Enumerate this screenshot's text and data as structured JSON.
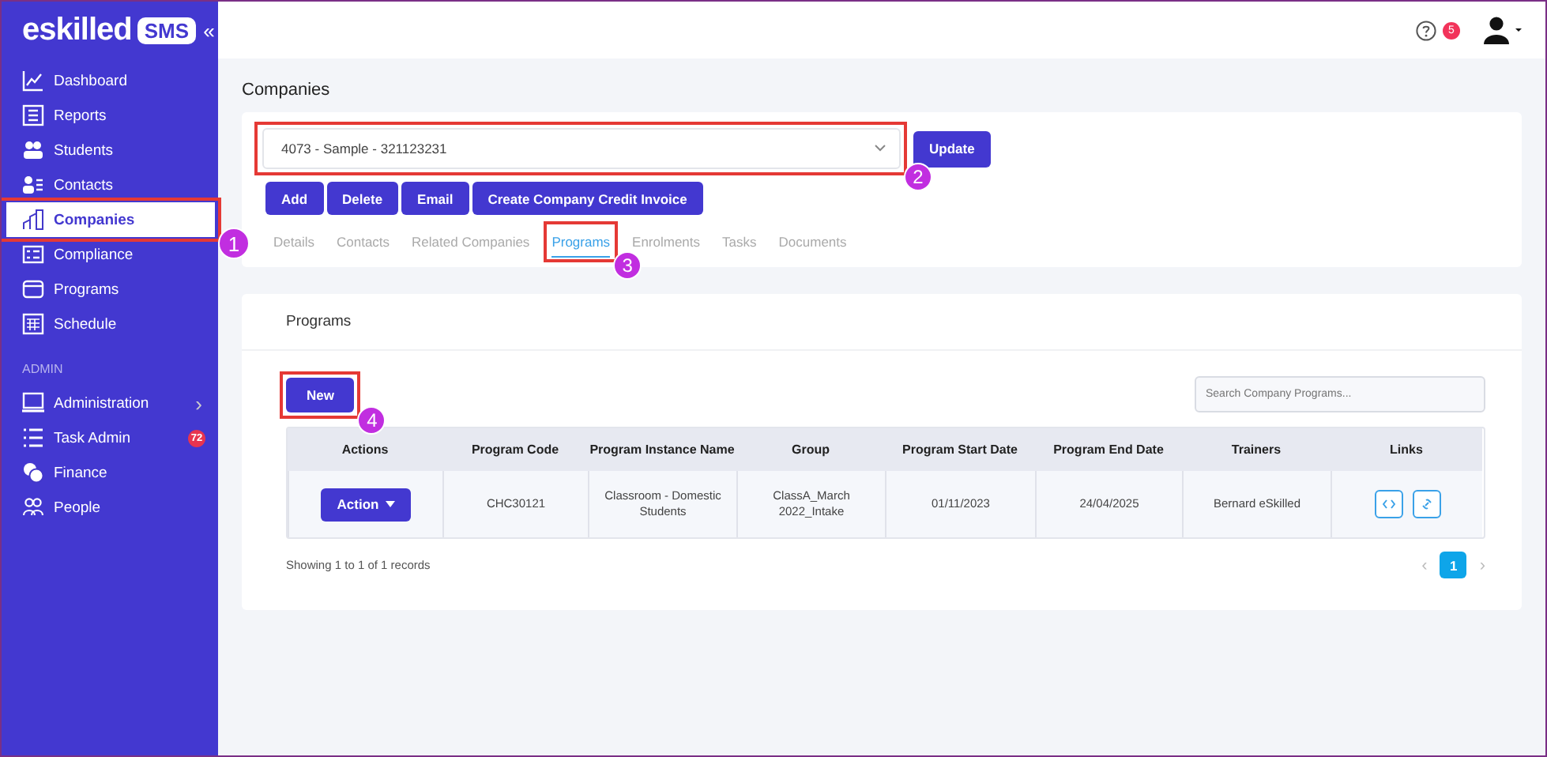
{
  "logo": {
    "text": "eskilled",
    "badge": "SMS",
    "collapse": "«"
  },
  "sidebar": {
    "items": [
      {
        "label": "Dashboard",
        "selected": false
      },
      {
        "label": "Reports",
        "selected": false
      },
      {
        "label": "Students",
        "selected": false
      },
      {
        "label": "Contacts",
        "selected": false
      },
      {
        "label": "Companies",
        "selected": true,
        "callout": "1"
      },
      {
        "label": "Compliance",
        "selected": false
      },
      {
        "label": "Programs",
        "selected": false
      },
      {
        "label": "Schedule",
        "selected": false
      }
    ],
    "section": "ADMIN",
    "admin_items": [
      {
        "label": "Administration",
        "selected": false,
        "chevron": "›"
      },
      {
        "label": "Task Admin",
        "selected": false,
        "badge": "72"
      },
      {
        "label": "Finance",
        "selected": false
      },
      {
        "label": "People",
        "selected": false
      }
    ]
  },
  "topbar": {
    "notification_count": "5"
  },
  "page_title": "Companies",
  "company": {
    "value": "4073 - Sample - 321123231",
    "callout": "2",
    "update": "Update",
    "buttons": [
      "Add",
      "Delete",
      "Email",
      "Create Company Credit Invoice"
    ],
    "tabs": [
      {
        "label": "Details",
        "selected": false
      },
      {
        "label": "Contacts",
        "selected": false
      },
      {
        "label": "Related Companies",
        "selected": false
      },
      {
        "label": "Programs",
        "selected": true,
        "callout": "3"
      },
      {
        "label": "Enrolments",
        "selected": false
      },
      {
        "label": "Tasks",
        "selected": false
      },
      {
        "label": "Documents",
        "selected": false
      }
    ]
  },
  "programs": {
    "title": "Programs",
    "new_button": "New",
    "new_callout": "4",
    "search": {
      "placeholder": "Search Company Programs..."
    },
    "table": {
      "columns": [
        "Actions",
        "Program Code",
        "Program Instance Name",
        "Group",
        "Program Start Date",
        "Program End Date",
        "Trainers",
        "Links"
      ],
      "rows": [
        {
          "action": "Action",
          "program_code": "CHC30121",
          "instance_name": "Classroom - Domestic Students",
          "group": "ClassA_March 2022_Intake",
          "start_date": "01/11/2023",
          "end_date": "24/04/2025",
          "trainers": "Bernard eSkilled"
        }
      ]
    },
    "footer": "Showing 1 to 1 of 1 records",
    "pagination": {
      "prev": "‹",
      "next": "›",
      "pages": [
        {
          "label": "1",
          "selected": true
        }
      ]
    }
  }
}
